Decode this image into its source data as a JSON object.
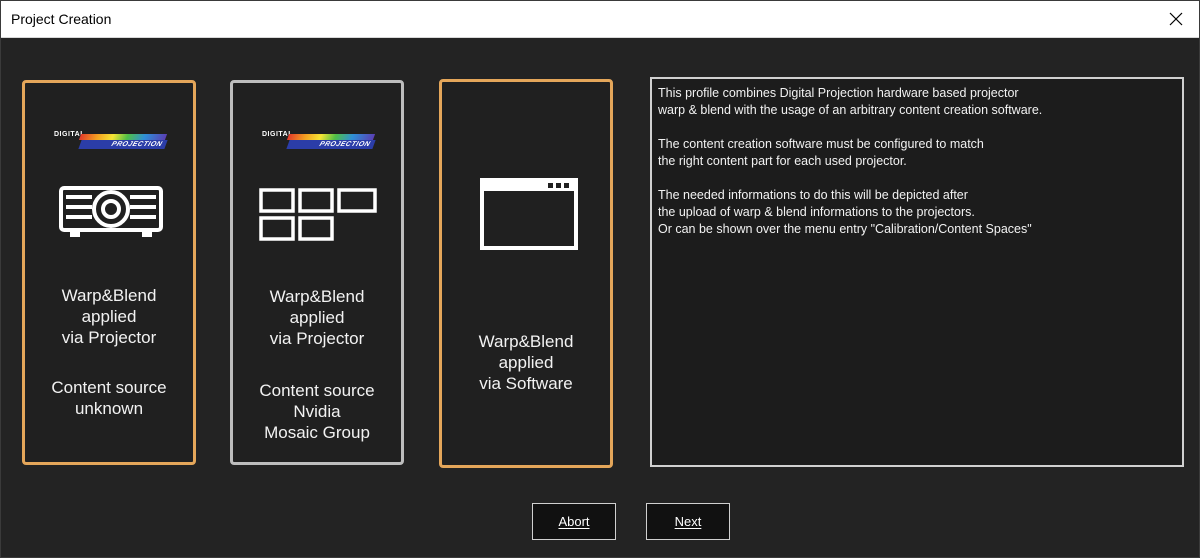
{
  "window": {
    "title": "Project Creation"
  },
  "brand": {
    "top": "DIGITAL",
    "bottom": "PROJECTION"
  },
  "cards": [
    {
      "label_line1": "Warp&Blend",
      "label_line2": "applied",
      "label_line3": "via Projector",
      "source_line1": "Content source",
      "source_line2": "unknown",
      "icon": "projector-icon",
      "selected": true
    },
    {
      "label_line1": "Warp&Blend",
      "label_line2": "applied",
      "label_line3": "via Projector",
      "source_line1": "Content source",
      "source_line2": "Nvidia",
      "source_line3": "Mosaic Group",
      "icon": "display-grid-icon",
      "selected": false
    },
    {
      "label_line1": "Warp&Blend",
      "label_line2": "applied",
      "label_line3": "via Software",
      "icon": "application-window-icon",
      "selected": true
    }
  ],
  "info": {
    "paragraph1": "This profile combines Digital Projection hardware based projector\nwarp & blend with the usage of an arbitrary content creation software.",
    "paragraph2": "The content creation software must be configured to match\nthe right content part for each used projector.",
    "paragraph3": "The needed informations to do this will be depicted after\nthe upload of warp & blend informations to the projectors.\nOr can be shown over the menu entry \"Calibration/Content Spaces\""
  },
  "buttons": {
    "abort": "Abort",
    "next": "Next"
  },
  "colors": {
    "background": "#232323",
    "accent": "#e4a65a",
    "neutral_border": "#bdbdbd"
  }
}
